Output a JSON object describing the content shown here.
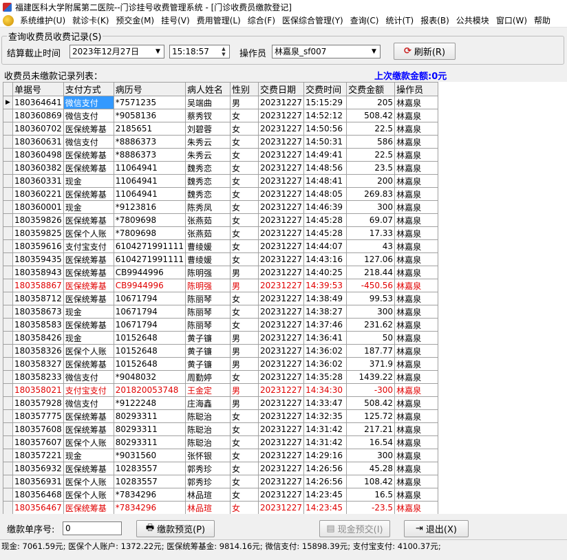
{
  "window": {
    "title": "福建医科大学附属第二医院--门诊挂号收费管理系统 - [门诊收费员缴款登记]"
  },
  "menu": [
    "系统维护(U)",
    "就诊卡(K)",
    "预交金(M)",
    "挂号(V)",
    "费用管理(L)",
    "综合(F)",
    "医保综合管理(Y)",
    "查询(C)",
    "统计(T)",
    "报表(B)",
    "公共模块",
    "窗口(W)",
    "帮助"
  ],
  "query": {
    "group_title": "查询收费员收费记录(S)",
    "settle_label": "结算截止时间",
    "date_value": "2023年12月27日",
    "time_value": "15:18:57",
    "operator_label": "操作员",
    "operator_value": "林嘉泉_sf007",
    "refresh_label": "刷新(R)"
  },
  "list": {
    "label": "收费员未缴款记录列表：",
    "last_amount": "上次缴款金额:0元"
  },
  "grid": {
    "columns": [
      "单据号",
      "支付方式",
      "病历号",
      "病人姓名",
      "性别",
      "交费日期",
      "交费时间",
      "交费金额",
      "操作员"
    ],
    "rows": [
      [
        "180364641",
        "微信支付",
        "*7571235",
        "吴端曲",
        "男",
        "20231227",
        "15:15:29",
        "205",
        "林嘉泉"
      ],
      [
        "180360869",
        "微信支付",
        "*9058136",
        "蔡秀钗",
        "女",
        "20231227",
        "14:52:12",
        "508.42",
        "林嘉泉"
      ],
      [
        "180360702",
        "医保统筹基",
        "2185651",
        "刘碧蓉",
        "女",
        "20231227",
        "14:50:56",
        "22.5",
        "林嘉泉"
      ],
      [
        "180360631",
        "微信支付",
        "*8886373",
        "朱秀云",
        "女",
        "20231227",
        "14:50:31",
        "586",
        "林嘉泉"
      ],
      [
        "180360498",
        "医保统筹基",
        "*8886373",
        "朱秀云",
        "女",
        "20231227",
        "14:49:41",
        "22.5",
        "林嘉泉"
      ],
      [
        "180360382",
        "医保统筹基",
        "11064941",
        "魏秀恋",
        "女",
        "20231227",
        "14:48:56",
        "23.5",
        "林嘉泉"
      ],
      [
        "180360331",
        "现金",
        "11064941",
        "魏秀恋",
        "女",
        "20231227",
        "14:48:41",
        "200",
        "林嘉泉"
      ],
      [
        "180360221",
        "医保统筹基",
        "11064941",
        "魏秀恋",
        "女",
        "20231227",
        "14:48:05",
        "269.83",
        "林嘉泉"
      ],
      [
        "180360001",
        "现金",
        "*9123816",
        "陈秀凤",
        "女",
        "20231227",
        "14:46:39",
        "300",
        "林嘉泉"
      ],
      [
        "180359826",
        "医保统筹基",
        "*7809698",
        "张燕茹",
        "女",
        "20231227",
        "14:45:28",
        "69.07",
        "林嘉泉"
      ],
      [
        "180359825",
        "医保个人账",
        "*7809698",
        "张燕茹",
        "女",
        "20231227",
        "14:45:28",
        "17.33",
        "林嘉泉"
      ],
      [
        "180359616",
        "支付宝支付",
        "6104271991111",
        "曹绫媛",
        "女",
        "20231227",
        "14:44:07",
        "43",
        "林嘉泉"
      ],
      [
        "180359435",
        "医保统筹基",
        "6104271991111",
        "曹绫媛",
        "女",
        "20231227",
        "14:43:16",
        "127.06",
        "林嘉泉"
      ],
      [
        "180358943",
        "医保统筹基",
        "CB9944996",
        "陈明强",
        "男",
        "20231227",
        "14:40:25",
        "218.44",
        "林嘉泉"
      ],
      [
        "180358867",
        "医保统筹基",
        "CB9944996",
        "陈明强",
        "男",
        "20231227",
        "14:39:53",
        "-450.56",
        "林嘉泉"
      ],
      [
        "180358712",
        "医保统筹基",
        "10671794",
        "陈丽琴",
        "女",
        "20231227",
        "14:38:49",
        "99.53",
        "林嘉泉"
      ],
      [
        "180358673",
        "现金",
        "10671794",
        "陈丽琴",
        "女",
        "20231227",
        "14:38:27",
        "300",
        "林嘉泉"
      ],
      [
        "180358583",
        "医保统筹基",
        "10671794",
        "陈丽琴",
        "女",
        "20231227",
        "14:37:46",
        "231.62",
        "林嘉泉"
      ],
      [
        "180358426",
        "现金",
        "10152648",
        "黄子镰",
        "男",
        "20231227",
        "14:36:41",
        "50",
        "林嘉泉"
      ],
      [
        "180358326",
        "医保个人账",
        "10152648",
        "黄子镰",
        "男",
        "20231227",
        "14:36:02",
        "187.77",
        "林嘉泉"
      ],
      [
        "180358327",
        "医保统筹基",
        "10152648",
        "黄子镰",
        "男",
        "20231227",
        "14:36:02",
        "371.9",
        "林嘉泉"
      ],
      [
        "180358233",
        "微信支付",
        "*9048032",
        "周勤婷",
        "女",
        "20231227",
        "14:35:28",
        "1439.22",
        "林嘉泉"
      ],
      [
        "180358021",
        "支付宝支付",
        "201820053748",
        "王金定",
        "男",
        "20231227",
        "14:34:30",
        "-300",
        "林嘉泉"
      ],
      [
        "180357928",
        "微信支付",
        "*9122248",
        "庄海鑫",
        "男",
        "20231227",
        "14:33:47",
        "508.42",
        "林嘉泉"
      ],
      [
        "180357775",
        "医保统筹基",
        "80293311",
        "陈聪治",
        "女",
        "20231227",
        "14:32:35",
        "125.72",
        "林嘉泉"
      ],
      [
        "180357608",
        "医保统筹基",
        "80293311",
        "陈聪治",
        "女",
        "20231227",
        "14:31:42",
        "217.21",
        "林嘉泉"
      ],
      [
        "180357607",
        "医保个人账",
        "80293311",
        "陈聪治",
        "女",
        "20231227",
        "14:31:42",
        "16.54",
        "林嘉泉"
      ],
      [
        "180357221",
        "现金",
        "*9031560",
        "张怀银",
        "女",
        "20231227",
        "14:29:16",
        "300",
        "林嘉泉"
      ],
      [
        "180356932",
        "医保统筹基",
        "10283557",
        "郭秀珍",
        "女",
        "20231227",
        "14:26:56",
        "45.28",
        "林嘉泉"
      ],
      [
        "180356931",
        "医保个人账",
        "10283557",
        "郭秀珍",
        "女",
        "20231227",
        "14:26:56",
        "108.42",
        "林嘉泉"
      ],
      [
        "180356468",
        "医保个人账",
        "*7834296",
        "林品瑄",
        "女",
        "20231227",
        "14:23:45",
        "16.5",
        "林嘉泉"
      ],
      [
        "180356467",
        "医保统筹基",
        "*7834296",
        "林品瑄",
        "女",
        "20231227",
        "14:23:45",
        "-23.5",
        "林嘉泉"
      ]
    ],
    "negative_rows": [
      14,
      22,
      31
    ],
    "selected_row": 0,
    "row_indicator": "▶"
  },
  "bottom": {
    "serial_label": "缴款单序号:",
    "serial_value": "0",
    "preview_label": "缴款预览(P)",
    "cash_preview_label": "现金预交(I)",
    "exit_label": "退出(X)"
  },
  "status": "现金: 7061.59元; 医保个人账户: 1372.22元; 医保统筹基金: 9814.16元; 微信支付: 15898.39元; 支付宝支付: 4100.37元;",
  "colors": {
    "negative": "#e00000",
    "selection": "#3399ff",
    "last_amount": "#0000ff"
  }
}
